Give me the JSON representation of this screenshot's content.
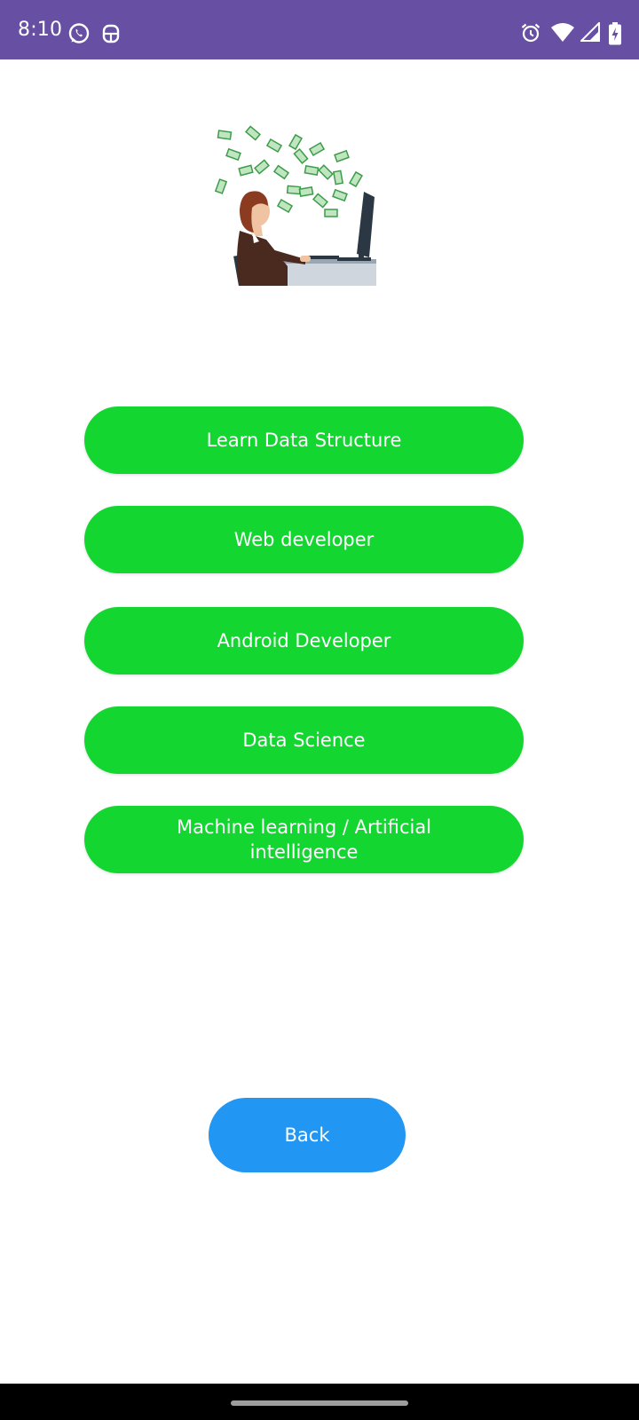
{
  "status_bar": {
    "time": "8:10",
    "left_icons": [
      "whatsapp-icon",
      "app-notification-icon"
    ],
    "right_icons": [
      "alarm-icon",
      "wifi-icon",
      "cell-signal-icon",
      "battery-charging-icon"
    ],
    "background": "#6750a4"
  },
  "illustration": {
    "icon": "woman-at-computer-money-icon"
  },
  "tracks": [
    {
      "label": "Learn Data Structure"
    },
    {
      "label": "Web developer"
    },
    {
      "label": "Android Developer"
    },
    {
      "label": "Data Science"
    },
    {
      "label": "Machine learning / Artificial intelligence"
    }
  ],
  "back_label": "Back",
  "colors": {
    "track_button": "#13d631",
    "back_button": "#2196f3"
  }
}
